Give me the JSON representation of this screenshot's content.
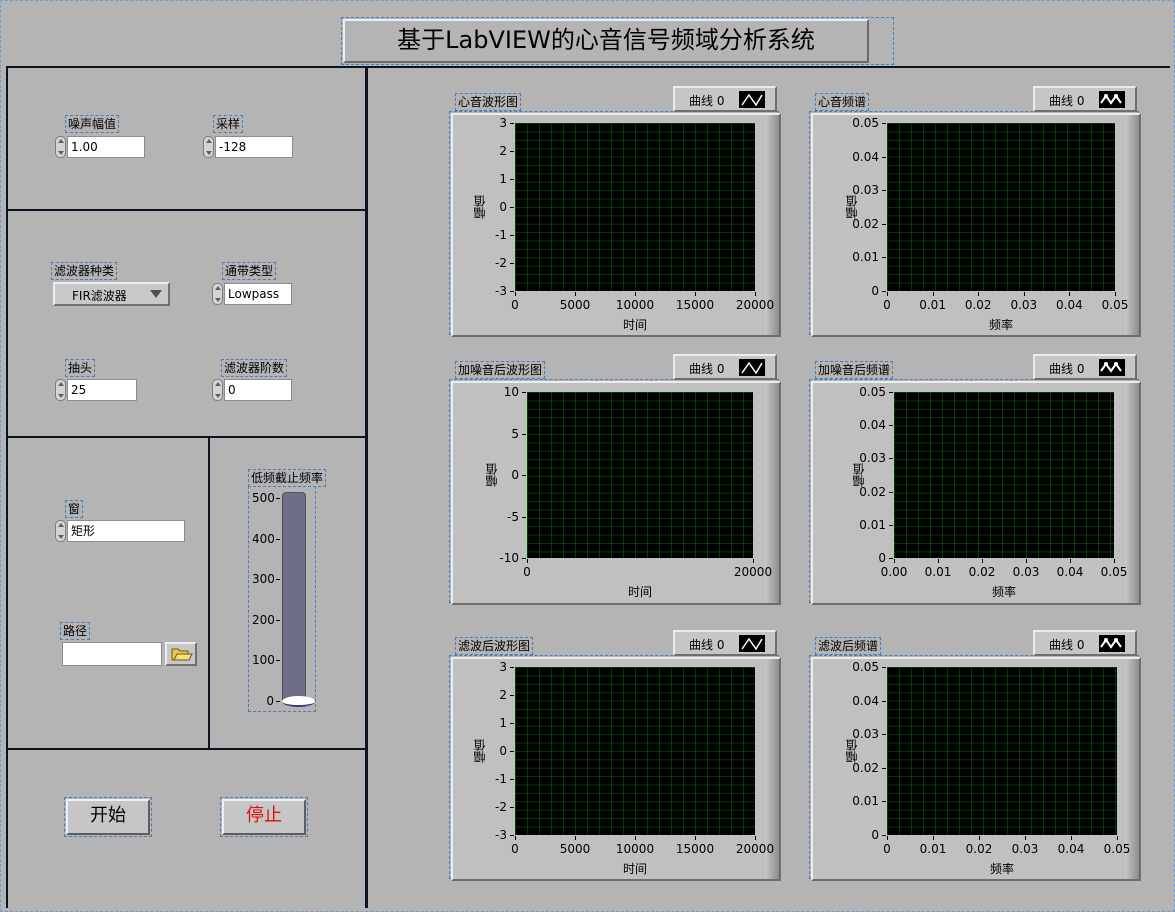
{
  "title": "基于LabVIEW的心音信号频域分析系统",
  "colors": {
    "plot_bg": "#000000",
    "grid": "#007a00",
    "panel_line": "#0b1420",
    "stop_text": "#e01010",
    "slider_fill": "#6e6e88"
  },
  "controls": {
    "noise_amplitude": {
      "label": "噪声幅值",
      "value": "1.00"
    },
    "sampling": {
      "label": "采样",
      "value": "-128"
    },
    "filter_type": {
      "label": "滤波器种类",
      "value": "FIR滤波器"
    },
    "passband_type": {
      "label": "通带类型",
      "value": "Lowpass"
    },
    "taps": {
      "label": "抽头",
      "value": "25"
    },
    "filter_order": {
      "label": "滤波器阶数",
      "value": "0"
    },
    "window": {
      "label": "窗",
      "value": "矩形"
    },
    "path": {
      "label": "路径",
      "value": ""
    },
    "lowpass_cutoff": {
      "label": "低频截止频率",
      "ticks": [
        "500",
        "400",
        "300",
        "200",
        "100",
        "0"
      ],
      "value": 0,
      "max": 500
    }
  },
  "buttons": {
    "start": "开始",
    "stop": "停止"
  },
  "legend_label": "曲线 0",
  "graphs": {
    "g1": {
      "title": "心音波形图",
      "xlabel": "时间",
      "ylabel": "幅值",
      "xticks": [
        "0",
        "5000",
        "10000",
        "15000",
        "20000"
      ],
      "yticks": [
        "3",
        "2",
        "1",
        "0",
        "-1",
        "-2",
        "-3"
      ]
    },
    "g2": {
      "title": "心音频谱",
      "xlabel": "频率",
      "ylabel": "幅值",
      "xticks": [
        "0",
        "0.01",
        "0.02",
        "0.03",
        "0.04",
        "0.05"
      ],
      "yticks": [
        "0.05",
        "0.04",
        "0.03",
        "0.02",
        "0.01",
        "0"
      ]
    },
    "g3": {
      "title": "加噪音后波形图",
      "xlabel": "时间",
      "ylabel": "幅值",
      "xticks": [
        "0",
        "20000"
      ],
      "yticks": [
        "10",
        "5",
        "0",
        "-5",
        "-10"
      ]
    },
    "g4": {
      "title": "加噪音后频谱",
      "xlabel": "频率",
      "ylabel": "幅值",
      "xticks": [
        "0.00",
        "0.01",
        "0.02",
        "0.03",
        "0.04",
        "0.05"
      ],
      "yticks": [
        "0.05",
        "0.04",
        "0.03",
        "0.02",
        "0.01",
        "0"
      ]
    },
    "g5": {
      "title": "滤波后波形图",
      "xlabel": "时间",
      "ylabel": "幅值",
      "xticks": [
        "0",
        "5000",
        "10000",
        "15000",
        "20000"
      ],
      "yticks": [
        "3",
        "2",
        "1",
        "0",
        "-1",
        "-2",
        "-3"
      ]
    },
    "g6": {
      "title": "滤波后频谱",
      "xlabel": "频率",
      "ylabel": "幅值",
      "xticks": [
        "0",
        "0.01",
        "0.02",
        "0.03",
        "0.04",
        "0.05"
      ],
      "yticks": [
        "0.05",
        "0.04",
        "0.03",
        "0.02",
        "0.01",
        "0"
      ]
    }
  }
}
